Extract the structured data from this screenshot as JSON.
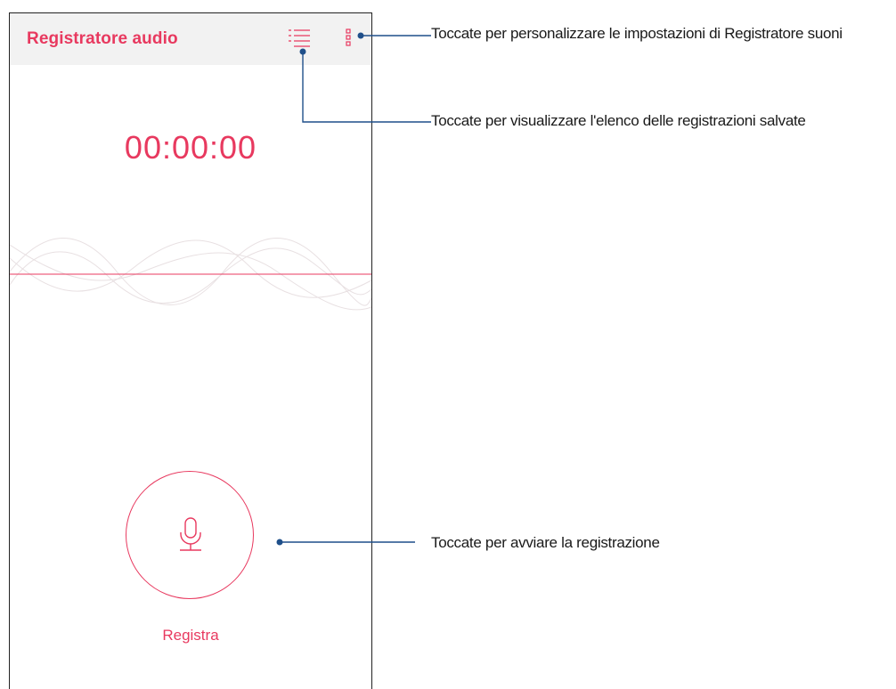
{
  "colors": {
    "accent": "#e8395f",
    "appbar_bg": "#f2f2f2",
    "callout_line": "#1f4f8a"
  },
  "app": {
    "title": "Registratore audio",
    "list_icon": "list-icon",
    "more_icon": "more-vertical-icon"
  },
  "timer": {
    "value": "00:00:00"
  },
  "record": {
    "icon": "microphone-icon",
    "label": "Registra"
  },
  "callouts": {
    "settings": "Toccate per personalizzare le impostazioni di Registratore suoni",
    "list": "Toccate per visualizzare l'elenco delle registrazioni salvate",
    "record": "Toccate per avviare la registrazione"
  }
}
